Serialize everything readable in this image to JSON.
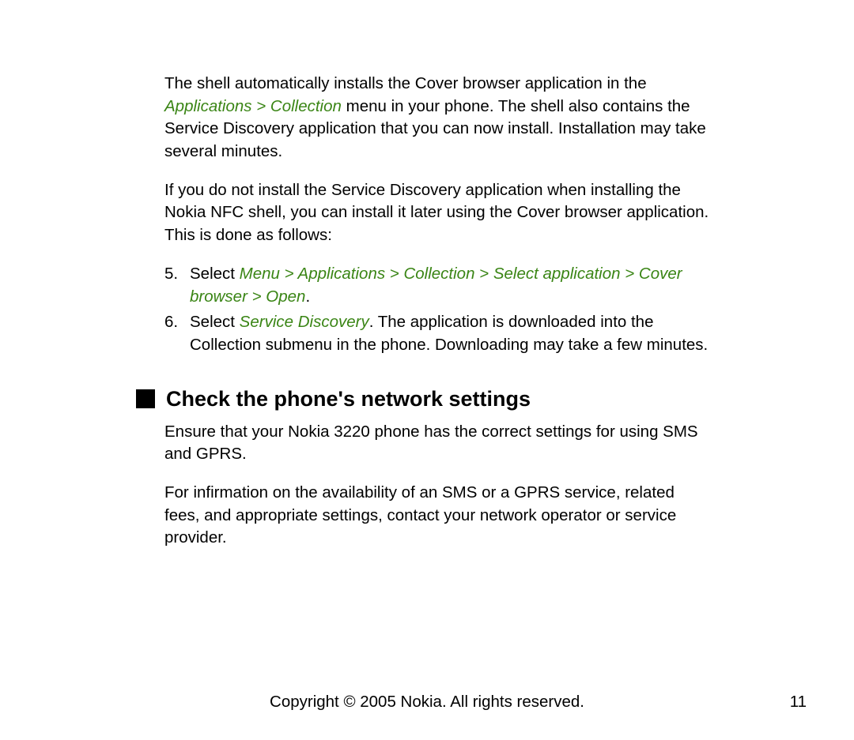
{
  "para1_pre": "The shell automatically installs the Cover browser application in the ",
  "para1_green": "Applications > Collection",
  "para1_post": " menu in your phone. The shell also contains the Service Discovery application that you can now install. Installation may take several minutes.",
  "para2": "If you do not install the Service Discovery application when installing the Nokia NFC shell, you can install it later using the Cover browser application. This is done as follows:",
  "item5_num": "5.",
  "item5_pre": "Select ",
  "item5_green": "Menu > Applications > Collection > Select application > Cover browser > Open",
  "item5_post": ".",
  "item6_num": "6.",
  "item6_pre": "Select ",
  "item6_green": "Service Discovery",
  "item6_post": ". The application is downloaded into the Collection submenu in the phone. Downloading may take a few minutes.",
  "heading": "Check the phone's network settings",
  "sec_para1": "Ensure that your Nokia 3220 phone has the correct settings for using SMS and GPRS.",
  "sec_para2": "For infirmation on the availability of an SMS or a GPRS service, related fees, and appropriate settings, contact your network operator or service provider.",
  "footer": "Copyright © 2005 Nokia. All rights reserved.",
  "page_number": "11"
}
